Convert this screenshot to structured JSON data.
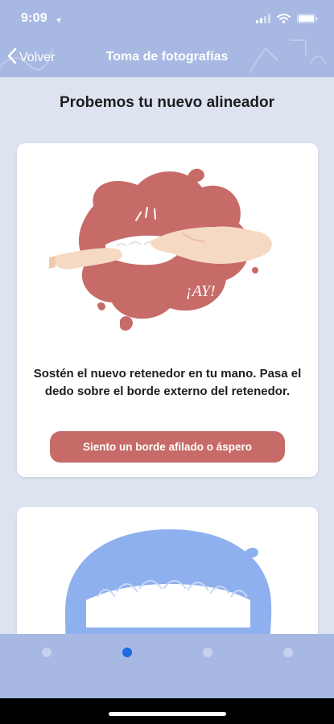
{
  "status_bar": {
    "time": "9:09"
  },
  "nav": {
    "back_label": "Volver",
    "title": "Toma de fotografías"
  },
  "page": {
    "title": "Probemos tu nuevo alineador"
  },
  "card_1": {
    "illustration_text": "¡AY!",
    "instruction": "Sostén el nuevo retenedor en tu mano. Pasa el dedo sobre el borde externo del retenedor.",
    "button_label": "Siento un borde afilado o áspero"
  },
  "pager": {
    "active_index": 1,
    "total": 4
  },
  "colors": {
    "header_bg": "#a7b9e2",
    "page_bg": "#dde4f0",
    "button_bg": "#c76b68",
    "blob_red": "#c76b68",
    "blob_blue": "#8fb0ef",
    "active_dot": "#1d6be0",
    "inactive_dot": "#c6d1ee"
  },
  "icons": [
    "location-arrow-icon",
    "cellular-signal-icon",
    "wifi-icon",
    "battery-icon",
    "chevron-left-icon"
  ]
}
